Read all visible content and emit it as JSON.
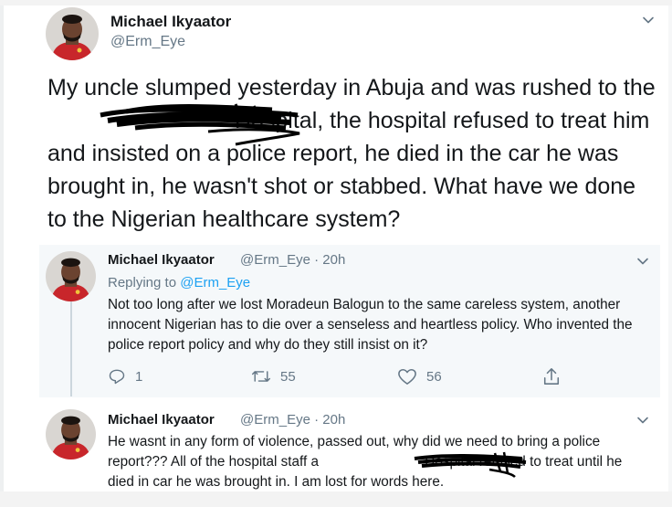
{
  "main_tweet": {
    "name": "Michael Ikyaator",
    "handle": "@Erm_Eye",
    "text_before_redaction": "My uncle slumped yesterday in Abuja and was rushed to the",
    "text_after_redaction": " Hospital, the hospital refused to treat him and insisted on a police report, he died in the car he was brought in, he wasn't shot or stabbed. What have we done to the Nigerian healthcare system?"
  },
  "replies": [
    {
      "name": "Michael Ikyaator",
      "handle": "@Erm_Eye",
      "separator": "·",
      "time": "20h",
      "replying_prefix": "Replying to",
      "replying_to": "@Erm_Eye",
      "text": "Not too long after we lost Moradeun Balogun to the same careless system, another innocent Nigerian has to die over a senseless and heartless policy. Who invented the police report policy and why do they still insist on it?",
      "actions": {
        "reply_count": "1",
        "retweet_count": "55",
        "like_count": "56"
      }
    },
    {
      "name": "Michael Ikyaator",
      "handle": "@Erm_Eye",
      "separator": "·",
      "time": "20h",
      "text_before_redaction": "He wasnt in any form of violence, passed out, why did we need to bring a police report??? All of the hospital staff a",
      "text_after_redaction": " Hospital refused to treat until he died in car he was brought in. I am lost for words here."
    }
  ],
  "icons": {
    "menu": "chevron-down-icon",
    "reply": "reply-icon",
    "retweet": "retweet-icon",
    "like": "heart-icon",
    "share": "share-icon",
    "redaction": "scribble-redaction"
  },
  "colors": {
    "accent": "#1da1f2",
    "secondary_text": "#657786",
    "primary_text": "#14171a",
    "reply_card_bg": "#f5f8fa"
  }
}
